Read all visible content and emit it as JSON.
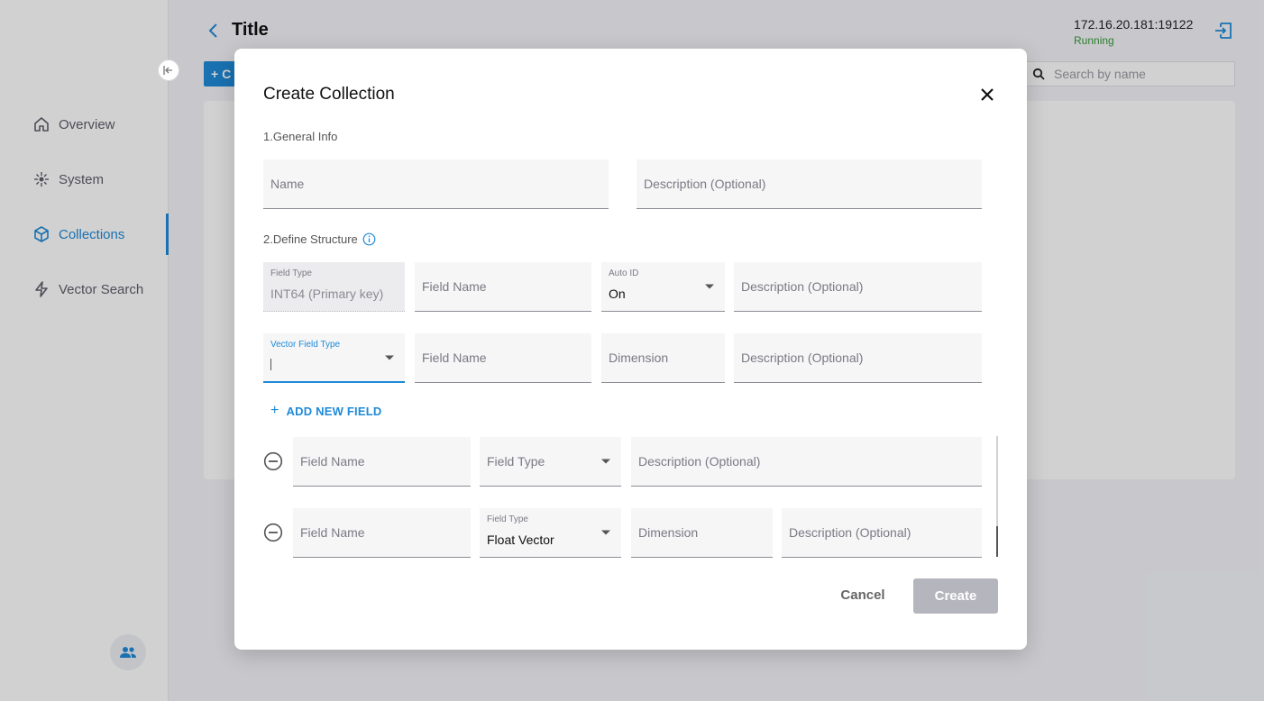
{
  "sidebar": {
    "items": [
      {
        "label": "Overview",
        "icon": "home-icon"
      },
      {
        "label": "System",
        "icon": "system-icon"
      },
      {
        "label": "Collections",
        "icon": "cube-icon"
      },
      {
        "label": "Vector Search",
        "icon": "bolt-icon"
      }
    ],
    "active_item": "Collections"
  },
  "header": {
    "title": "Title",
    "server_address": "172.16.20.181:19122",
    "server_status": "Running",
    "create_button_label": "+ C",
    "search_placeholder": "Search by name"
  },
  "modal": {
    "title": "Create Collection",
    "section1": "1.General Info",
    "section2": "2.Define Structure",
    "name_placeholder": "Name",
    "description_placeholder": "Description (Optional)",
    "primary_field": {
      "type_label": "Field Type",
      "type_value": "INT64 (Primary key)",
      "name_placeholder": "Field Name",
      "auto_id_label": "Auto ID",
      "auto_id_value": "On",
      "description_placeholder": "Description (Optional)"
    },
    "vector_field": {
      "type_label": "Vector Field Type",
      "name_placeholder": "Field Name",
      "dimension_placeholder": "Dimension",
      "description_placeholder": "Description (Optional)"
    },
    "add_field_label": "ADD NEW FIELD",
    "extra_field_1": {
      "name_placeholder": "Field Name",
      "type_placeholder": "Field Type",
      "description_placeholder": "Description (Optional)"
    },
    "extra_field_2": {
      "name_placeholder": "Field Name",
      "type_label": "Field Type",
      "type_value": "Float Vector",
      "dimension_placeholder": "Dimension",
      "description_placeholder": "Description (Optional)"
    },
    "cancel_label": "Cancel",
    "create_label": "Create"
  },
  "colors": {
    "accent": "#1f8ad8",
    "status_running": "#3a9a3a",
    "disabled_button": "#b5b5bd"
  }
}
